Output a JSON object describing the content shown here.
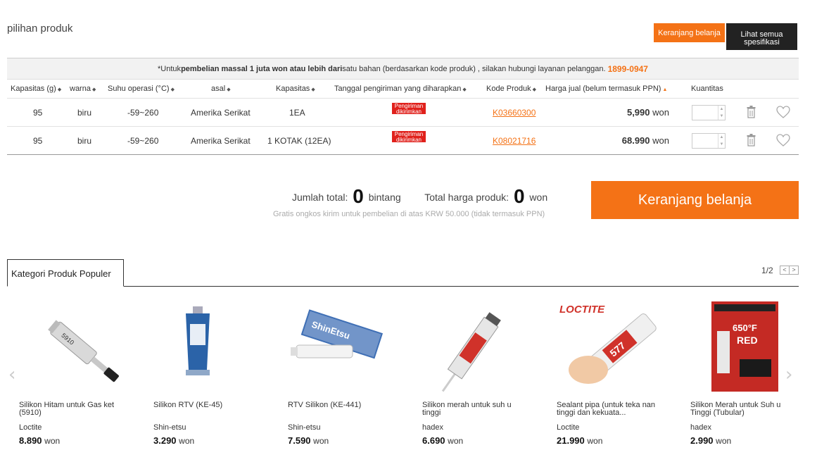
{
  "section": {
    "title": "pilihan produk"
  },
  "top_buttons": {
    "cart": "Keranjang belanja",
    "spec_line1": "Lihat semua",
    "spec_line2": "spesifikasi"
  },
  "notice": {
    "prefix": "*Untuk ",
    "bold": "pembelian massal 1 juta won atau lebih dari",
    "suffix": " satu bahan (berdasarkan kode produk)  , silakan hubungi layanan pelanggan.",
    "phone": "1899-0947"
  },
  "table": {
    "headers": [
      "Kapasitas (g)",
      "warna",
      "Suhu operasi (°C)",
      "asal",
      "Kapasitas",
      "Tanggal pengiriman yang diharapkan",
      "Kode Produk",
      "Harga jual (belum termasuk PPN)",
      "Kuantitas"
    ],
    "rows": [
      {
        "capacity_g": "95",
        "color": "biru",
        "temp": "-59~260",
        "origin": "Amerika Serikat",
        "capacity": "1EA",
        "shipping": "Pengiriman dikirimkan",
        "code": "K03660300",
        "price": "5,990",
        "unit": "won"
      },
      {
        "capacity_g": "95",
        "color": "biru",
        "temp": "-59~260",
        "origin": "Amerika Serikat",
        "capacity": "1 KOTAK (12EA)",
        "shipping": "Pengiriman dikirimkan",
        "code": "K08021716",
        "price": "68.990",
        "unit": "won"
      }
    ]
  },
  "summary": {
    "total_qty_label": "Jumlah total:",
    "total_qty": "0",
    "total_qty_unit": "bintang",
    "total_price_label": "Total harga produk:",
    "total_price": "0",
    "total_price_unit": "won",
    "free_shipping": "Gratis ongkos kirim untuk pembelian di atas KRW 50.000 (tidak termasuk PPN)",
    "cart_button": "Keranjang belanja"
  },
  "popular": {
    "tab": "Kategori Produk Populer",
    "page": "1/2",
    "prev_symbol": "<",
    "next_symbol": ">",
    "products": [
      {
        "name": "Silikon Hitam untuk Gas ket (5910)",
        "brand": "Loctite",
        "price": "8.890",
        "unit": "won",
        "icon": "gray-tube-icon"
      },
      {
        "name": "Silikon RTV (KE-45)",
        "brand": "Shin-etsu",
        "price": "3.290",
        "unit": "won",
        "icon": "blue-tube-icon"
      },
      {
        "name": "RTV Silikon (KE-441)",
        "brand": "Shin-etsu",
        "price": "7.590",
        "unit": "won",
        "icon": "box-tube-icon"
      },
      {
        "name": "Silikon merah untuk suh u tinggi",
        "brand": "hadex",
        "price": "6.690",
        "unit": "won",
        "icon": "cartridge-icon"
      },
      {
        "name": "Sealant pipa (untuk teka nan tinggi dan kekuata...",
        "brand": "Loctite",
        "price": "21.990",
        "unit": "won",
        "icon": "hand-tube-icon"
      },
      {
        "name": "Silikon Merah untuk Suh u Tinggi (Tubular)",
        "brand": "hadex",
        "price": "2.990",
        "unit": "won",
        "icon": "red-package-icon"
      }
    ]
  },
  "colors": {
    "accent": "#f47216",
    "badge": "#e0211c",
    "dark_button": "#222222"
  }
}
